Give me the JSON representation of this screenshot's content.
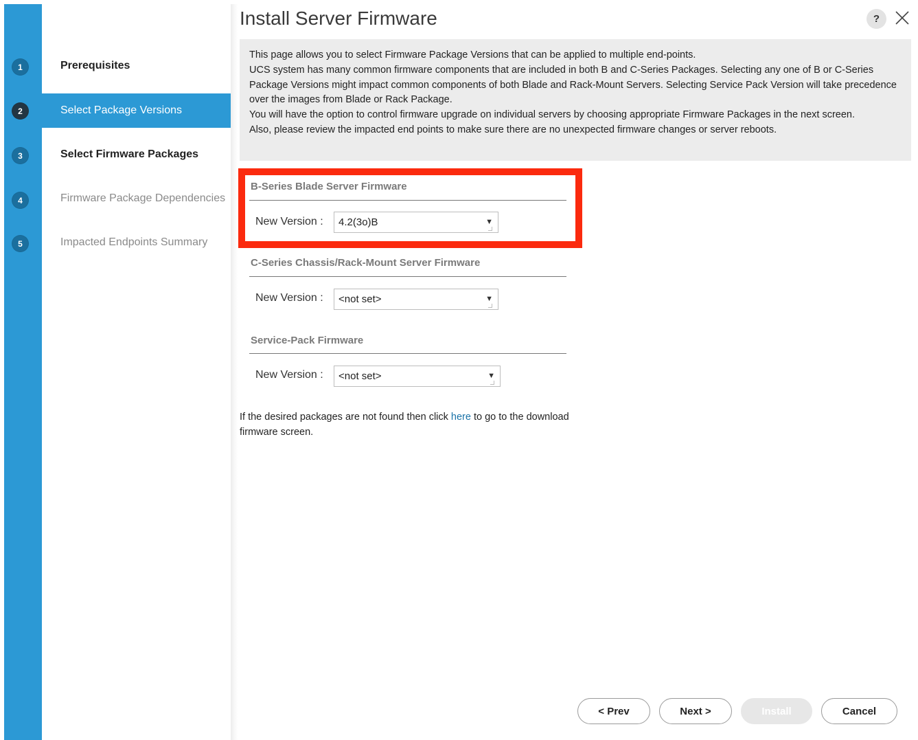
{
  "dialog": {
    "title": "Install Server Firmware",
    "help_label": "?",
    "close_icon": "close-icon",
    "help_icon": "help-icon"
  },
  "steps": [
    {
      "number": "1",
      "label": "Prerequisites",
      "state": "done"
    },
    {
      "number": "2",
      "label": "Select Package Versions",
      "state": "active"
    },
    {
      "number": "3",
      "label": "Select Firmware Packages",
      "state": "done"
    },
    {
      "number": "4",
      "label": "Firmware Package Dependencies",
      "state": "pending"
    },
    {
      "number": "5",
      "label": "Impacted Endpoints Summary",
      "state": "pending"
    }
  ],
  "info": {
    "line1": "This page allows you to select Firmware Package Versions that can be applied to multiple end-points.",
    "line2": "UCS system has many common firmware components that are included in both B and C-Series Packages. Selecting any one of B or C-Series Package Versions might impact common components of both Blade and Rack-Mount Servers. Selecting Service Pack Version will take precedence over the images from Blade or Rack Package.",
    "line3": "You will have the option to control firmware upgrade on individual servers by choosing appropriate Firmware Packages in the next screen.",
    "line4": "Also, please review the impacted end points to make sure there are no unexpected firmware changes or server reboots."
  },
  "sections": {
    "b_series": {
      "title": "B-Series Blade Server Firmware",
      "label": "New Version :",
      "value": "4.2(3o)B"
    },
    "c_series": {
      "title": "C-Series Chassis/Rack-Mount Server Firmware",
      "label": "New Version :",
      "value": "<not set>"
    },
    "service_pack": {
      "title": "Service-Pack Firmware",
      "label": "New Version :",
      "value": "<not set>"
    }
  },
  "note": {
    "before": "If the desired packages are not found then click ",
    "link": "here",
    "after": " to go to the download firmware screen."
  },
  "footer": {
    "prev": "< Prev",
    "next": "Next >",
    "install": "Install",
    "cancel": "Cancel"
  },
  "colors": {
    "rail_blue": "#2c99d5",
    "active_step_circle": "#233643",
    "highlight_red": "#fb2a0e",
    "link_blue": "#1a73a8"
  }
}
